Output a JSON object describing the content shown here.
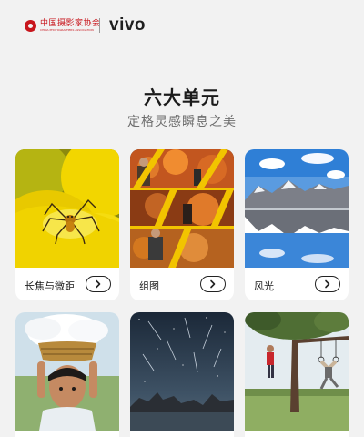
{
  "header": {
    "association_name_cn": "中国摄影家协会",
    "association_name_en": "CHINA PHOTOGRAPHERS ASSOCIATION",
    "brand": "vivo"
  },
  "main": {
    "title": "六大单元",
    "subtitle": "定格灵感瞬息之美"
  },
  "cards": [
    {
      "label": "长焦与微距",
      "image": "yellow-flower-spider"
    },
    {
      "label": "组图",
      "image": "photo-collage"
    },
    {
      "label": "风光",
      "image": "mountain-lake-reflection"
    },
    {
      "label": "",
      "image": "child-with-basket"
    },
    {
      "label": "",
      "image": "night-sky-meteors"
    },
    {
      "label": "",
      "image": "tree-swing-gymnasts"
    }
  ],
  "colors": {
    "background": "#f2f2f2",
    "brand_red": "#c8161d",
    "text": "#1b1b1b",
    "subtitle": "#6e6e6e"
  },
  "icons": {
    "card_button": "chevron-right-icon"
  }
}
